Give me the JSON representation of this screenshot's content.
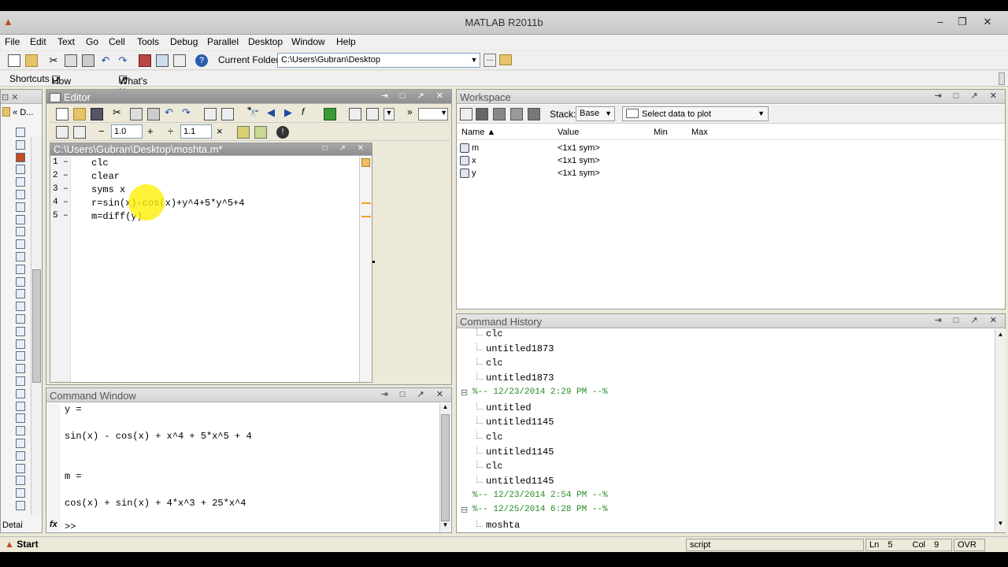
{
  "window": {
    "title": "MATLAB  R2011b",
    "logo_icon": "matlab-logo-icon"
  },
  "menu": [
    "File",
    "Edit",
    "Text",
    "Go",
    "Cell",
    "Tools",
    "Debug",
    "Parallel",
    "Desktop",
    "Window",
    "Help"
  ],
  "toolbar": {
    "current_folder_label": "Current Folder:",
    "current_folder_value": "C:\\Users\\Gubran\\Desktop"
  },
  "shortcuts": {
    "label": "Shortcuts",
    "how_to_add": "How to Add",
    "whats_new": "What's New"
  },
  "left_panel": {
    "nav": "« D...",
    "footer": "Detai"
  },
  "editor": {
    "panel_title": "Editor",
    "zoom_left": "1.0",
    "zoom_right": "1.1",
    "doc_title": "C:\\Users\\Gubran\\Desktop\\moshta.m*",
    "lines": [
      {
        "num": "1",
        "dash": "–",
        "code": "clc"
      },
      {
        "num": "2",
        "dash": "–",
        "code": "clear"
      },
      {
        "num": "3",
        "dash": "–",
        "code": "syms x"
      },
      {
        "num": "4",
        "dash": "–",
        "code": "r=sin(x)-cos(x)+y^4+5*y^5+4"
      },
      {
        "num": "5",
        "dash": "–",
        "code": "m=diff(y)"
      }
    ]
  },
  "command_window": {
    "title": "Command Window",
    "lines": [
      "y =",
      "",
      "sin(x) - cos(x) + x^4 + 5*x^5 + 4",
      "",
      "",
      "m =",
      "",
      "cos(x) + sin(x) + 4*x^3 + 25*x^4"
    ],
    "prompt": ">>",
    "fx": "fx"
  },
  "workspace": {
    "title": "Workspace",
    "stack_label": "Stack:",
    "stack_value": "Base",
    "plot_select": "Select data to plot",
    "columns": [
      "Name ▲",
      "Value",
      "Min",
      "Max"
    ],
    "rows": [
      {
        "name": "m",
        "value": "<1x1 sym>"
      },
      {
        "name": "x",
        "value": "<1x1 sym>"
      },
      {
        "name": "y",
        "value": "<1x1 sym>"
      }
    ]
  },
  "history": {
    "title": "Command History",
    "items": [
      {
        "text": "clc",
        "indent": true
      },
      {
        "text": "untitled1873",
        "indent": true
      },
      {
        "text": "clc",
        "indent": true
      },
      {
        "text": "untitled1873",
        "indent": true
      },
      {
        "text": "%-- 12/23/2014 2:29 PM --%",
        "indent": false,
        "collapse": "⊟"
      },
      {
        "text": "untitled",
        "indent": true
      },
      {
        "text": "untitled1145",
        "indent": true
      },
      {
        "text": "clc",
        "indent": true
      },
      {
        "text": "untitled1145",
        "indent": true
      },
      {
        "text": "clc",
        "indent": true
      },
      {
        "text": "untitled1145",
        "indent": true
      },
      {
        "text": "%-- 12/23/2014 2:54 PM --%",
        "indent": false,
        "collapse": ""
      },
      {
        "text": "%-- 12/25/2014 6:28 PM --%",
        "indent": false,
        "collapse": "⊟"
      },
      {
        "text": "moshta",
        "indent": true
      }
    ]
  },
  "status": {
    "start": "Start",
    "mode": "script",
    "ln_label": "Ln",
    "ln": "5",
    "col_label": "Col",
    "col": "9",
    "ovr": "OVR"
  }
}
